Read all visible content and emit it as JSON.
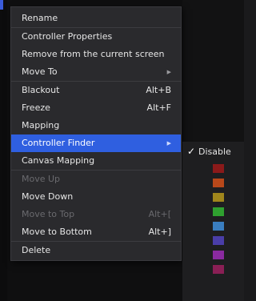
{
  "menu": {
    "items": [
      {
        "label": "Rename",
        "shortcut": "",
        "submenu": false,
        "disabled": false,
        "active": false
      },
      {
        "label": "Controller Properties",
        "shortcut": "",
        "submenu": false,
        "disabled": false,
        "active": false
      },
      {
        "label": "Remove from the current screen",
        "shortcut": "",
        "submenu": false,
        "disabled": false,
        "active": false
      },
      {
        "label": "Move To",
        "shortcut": "",
        "submenu": true,
        "disabled": false,
        "active": false
      },
      {
        "label": "Blackout",
        "shortcut": "Alt+B",
        "submenu": false,
        "disabled": false,
        "active": false
      },
      {
        "label": "Freeze",
        "shortcut": "Alt+F",
        "submenu": false,
        "disabled": false,
        "active": false
      },
      {
        "label": "Mapping",
        "shortcut": "",
        "submenu": false,
        "disabled": false,
        "active": false
      },
      {
        "label": "Controller Finder",
        "shortcut": "",
        "submenu": true,
        "disabled": false,
        "active": true
      },
      {
        "label": "Canvas Mapping",
        "shortcut": "",
        "submenu": false,
        "disabled": false,
        "active": false
      },
      {
        "label": "Move Up",
        "shortcut": "",
        "submenu": false,
        "disabled": true,
        "active": false
      },
      {
        "label": "Move Down",
        "shortcut": "",
        "submenu": false,
        "disabled": false,
        "active": false
      },
      {
        "label": "Move to Top",
        "shortcut": "Alt+[",
        "submenu": false,
        "disabled": true,
        "active": false
      },
      {
        "label": "Move to Bottom",
        "shortcut": "Alt+]",
        "submenu": false,
        "disabled": false,
        "active": false
      },
      {
        "label": "Delete",
        "shortcut": "",
        "submenu": false,
        "disabled": false,
        "active": false
      }
    ]
  },
  "submenu": {
    "disable_label": "Disable",
    "check_icon": "✓",
    "colors": [
      "#8b1a1a",
      "#b8481a",
      "#a0861c",
      "#2fa02f",
      "#3a7ec0",
      "#4a3ea8",
      "#8a2aa0",
      "#8a1f55"
    ]
  }
}
